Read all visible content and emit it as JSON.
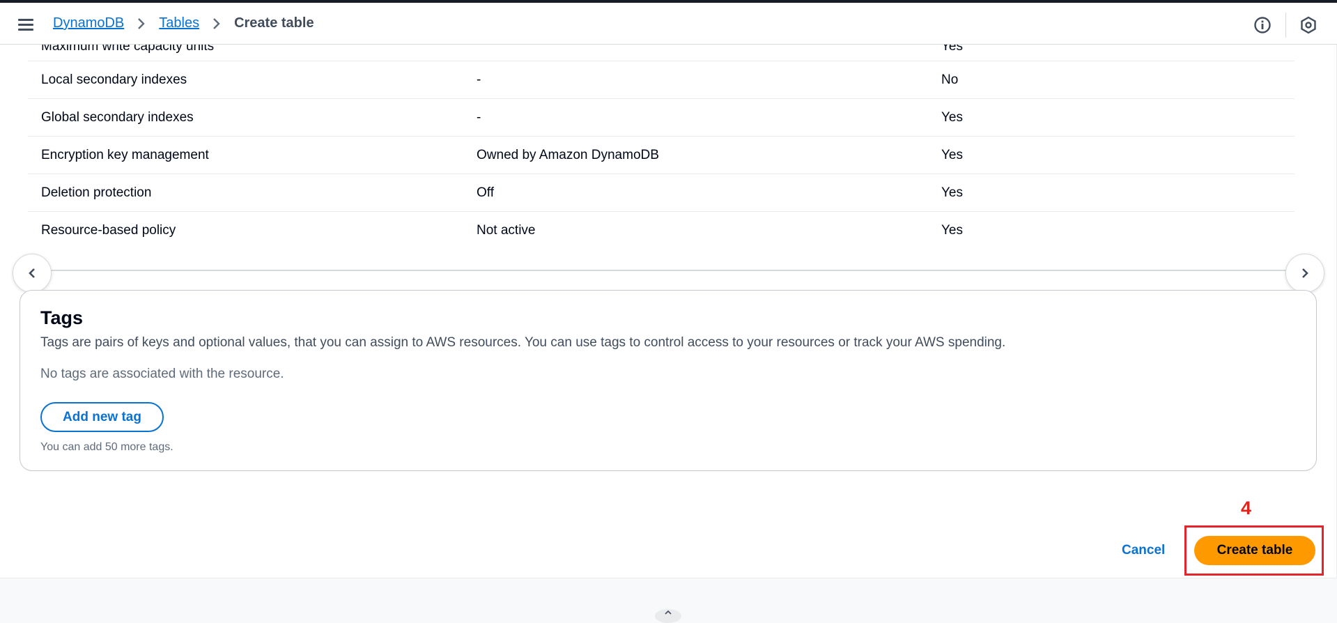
{
  "breadcrumb": {
    "items": [
      {
        "label": "DynamoDB"
      },
      {
        "label": "Tables"
      },
      {
        "label": "Create table"
      }
    ]
  },
  "settings_table": {
    "rows": [
      {
        "setting": "Maximum write capacity units",
        "value": "",
        "editable": "Yes"
      },
      {
        "setting": "Local secondary indexes",
        "value": "-",
        "editable": "No"
      },
      {
        "setting": "Global secondary indexes",
        "value": "-",
        "editable": "Yes"
      },
      {
        "setting": "Encryption key management",
        "value": "Owned by Amazon DynamoDB",
        "editable": "Yes"
      },
      {
        "setting": "Deletion protection",
        "value": "Off",
        "editable": "Yes"
      },
      {
        "setting": "Resource-based policy",
        "value": "Not active",
        "editable": "Yes"
      }
    ]
  },
  "tags": {
    "title": "Tags",
    "description": "Tags are pairs of keys and optional values, that you can assign to AWS resources. You can use tags to control access to your resources or track your AWS spending.",
    "empty_text": "No tags are associated with the resource.",
    "add_button": "Add new tag",
    "hint": "You can add 50 more tags."
  },
  "footer": {
    "cancel_label": "Cancel",
    "create_label": "Create table"
  },
  "annotation": {
    "step_number": "4",
    "color": "#e3242b"
  },
  "icons": {
    "menu": "hamburger-icon",
    "info": "info-icon",
    "settings": "hexagon-settings-icon",
    "scroll_left": "chevron-left-icon",
    "scroll_right": "chevron-right-icon"
  },
  "colors": {
    "primary_link": "#0972d3",
    "primary_button": "#ff9900"
  }
}
